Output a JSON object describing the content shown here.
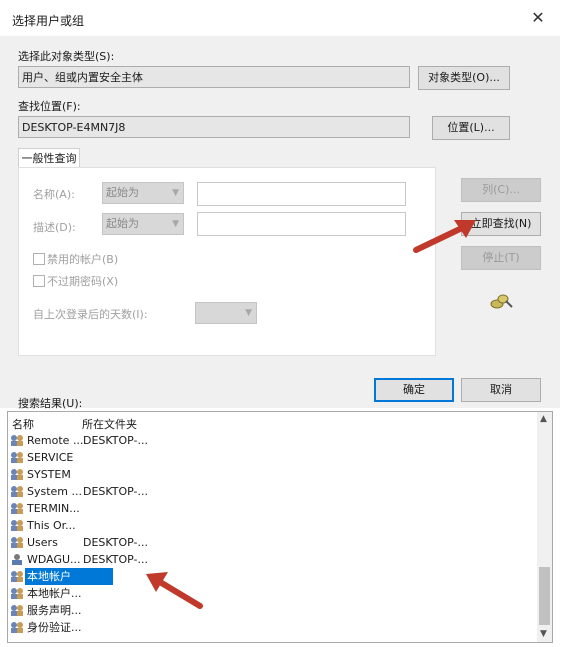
{
  "dialog": {
    "title": "选择用户或组",
    "close_glyph": "✕"
  },
  "object_type": {
    "label": "选择此对象类型(S):",
    "value": "用户、组或内置安全主体",
    "button": "对象类型(O)..."
  },
  "location": {
    "label": "查找位置(F):",
    "value": "DESKTOP-E4MN7J8",
    "button": "位置(L)..."
  },
  "query": {
    "tab": "一般性查询",
    "name_label": "名称(A):",
    "name_mode": "起始为",
    "desc_label": "描述(D):",
    "desc_mode": "起始为",
    "disabled_accounts": "禁用的帐户(B)",
    "non_expiring": "不过期密码(X)",
    "days_label": "自上次登录后的天数(I):"
  },
  "side_buttons": {
    "columns": "列(C)...",
    "find_now": "立即查找(N)",
    "stop": "停止(T)"
  },
  "actions": {
    "ok": "确定",
    "cancel": "取消"
  },
  "results": {
    "label": "搜索结果(U):",
    "headers": {
      "name": "名称",
      "folder": "所在文件夹"
    },
    "rows": [
      {
        "name": "Remote ...",
        "folder": "DESKTOP-..."
      },
      {
        "name": "SERVICE",
        "folder": ""
      },
      {
        "name": "SYSTEM",
        "folder": ""
      },
      {
        "name": "System ...",
        "folder": "DESKTOP-..."
      },
      {
        "name": "TERMIN...",
        "folder": ""
      },
      {
        "name": "This Or...",
        "folder": ""
      },
      {
        "name": "Users",
        "folder": "DESKTOP-..."
      },
      {
        "name": "WDAGU...",
        "folder": "DESKTOP-..."
      },
      {
        "name": "本地帐户",
        "folder": ""
      },
      {
        "name": "本地帐户...",
        "folder": ""
      },
      {
        "name": "服务声明...",
        "folder": ""
      },
      {
        "name": "身份验证...",
        "folder": ""
      }
    ],
    "selected_index": 8
  },
  "colors": {
    "selection": "#0078d7",
    "annotation_arrow": "#c0392b",
    "dialog_bg": "#f0f0f0"
  }
}
